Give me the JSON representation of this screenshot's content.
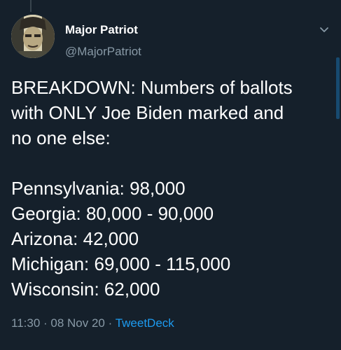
{
  "author": {
    "name": "Major Patriot",
    "handle": "@MajorPatriot"
  },
  "tweet": {
    "intro_lines": [
      "BREAKDOWN:  Numbers of ballots",
      "with ONLY Joe Biden marked and",
      "no one else:"
    ],
    "state_lines": [
      "Pennsylvania:  98,000",
      "Georgia:  80,000 - 90,000",
      "Arizona:  42,000",
      "Michigan:  69,000 - 115,000",
      "Wisconsin:  62,000"
    ]
  },
  "meta": {
    "time": "11:30",
    "separator1": " · ",
    "date": "08 Nov 20",
    "separator2": " · ",
    "source": "TweetDeck"
  },
  "icons": {
    "menu": "chevron-down-icon",
    "avatar": "avatar"
  },
  "colors": {
    "background": "#15202b",
    "text": "#ffffff",
    "secondary": "#8899a6",
    "link": "#1d9bf0"
  }
}
